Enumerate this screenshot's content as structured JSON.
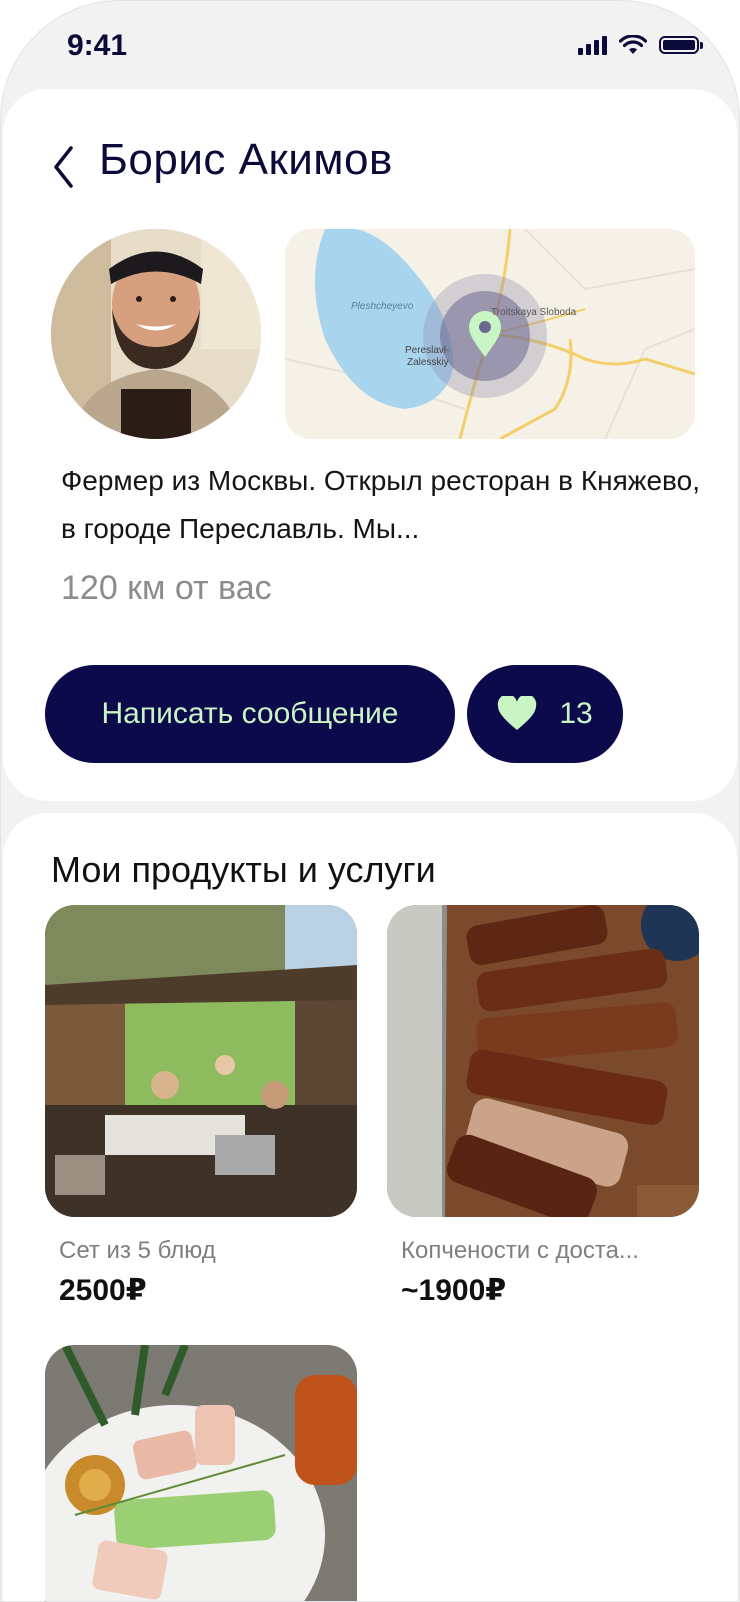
{
  "status_bar": {
    "time": "9:41"
  },
  "header": {
    "title": "Борис Акимов"
  },
  "profile": {
    "bio": "Фермер из Москвы. Открыл ресторан в Княжево, в городе Переславль. Мы...",
    "distance": "120 км от вас",
    "map": {
      "label_lake": "Pleshcheyevo",
      "label_town_1": "Pereslavl-",
      "label_town_2": "Zalesskiy",
      "label_village": "Troitskaya Sloboda"
    }
  },
  "actions": {
    "message_label": "Написать сообщение",
    "likes_count": "13"
  },
  "products": {
    "title": "Мои продукты и услуги",
    "items": [
      {
        "name": "Сет из 5 блюд",
        "price": "2500₽"
      },
      {
        "name": "Копчености с доста...",
        "price": "~1900₽"
      },
      {
        "name": "",
        "price": ""
      }
    ]
  },
  "colors": {
    "accent": "#0c0a4a",
    "accent_text": "#c9f5c5",
    "title": "#0b0b3a",
    "muted": "#8c8c8c"
  },
  "icons": [
    "chevron-left-icon",
    "signal-icon",
    "wifi-icon",
    "battery-icon",
    "map-pin-icon",
    "heart-icon"
  ]
}
